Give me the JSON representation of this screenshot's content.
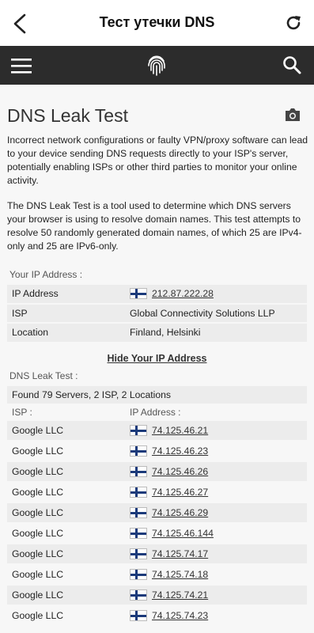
{
  "appbar": {
    "title": "Тест утечки DNS",
    "back_icon": "back-arrow-icon",
    "reload_icon": "reload-icon"
  },
  "navbar": {
    "menu_icon": "hamburger-menu-icon",
    "logo_icon": "fingerprint-icon",
    "search_icon": "search-icon",
    "bg_color": "#2c2c2c"
  },
  "page": {
    "title": "DNS Leak Test",
    "intro": "Incorrect network configurations or faulty VPN/proxy software can lead to your device sending DNS requests directly to your ISP's server, potentially enabling ISPs or other third parties to monitor your online activity.",
    "description": "The DNS Leak Test is a tool used to determine which DNS servers your browser is using to resolve domain names. This test attempts to resolve 50 randomly generated domain names, of which 25 are IPv4-only and 25 are IPv6-only."
  },
  "ip_section": {
    "label": "Your IP Address :",
    "rows": [
      {
        "key": "IP Address",
        "value": "212.87.222.28",
        "flag": true
      },
      {
        "key": "ISP",
        "value": "Global Connectivity Solutions LLP",
        "flag": false
      },
      {
        "key": "Location",
        "value": "Finland, Helsinki",
        "flag": false
      }
    ],
    "hide_link": "Hide Your IP Address"
  },
  "leak_section": {
    "label": "DNS Leak Test :",
    "summary": "Found 79 Servers, 2 ISP, 2 Locations",
    "col_isp": "ISP :",
    "col_ip": "IP Address :",
    "servers": [
      {
        "isp": "Google LLC",
        "ip": "74.125.46.21"
      },
      {
        "isp": "Google LLC",
        "ip": "74.125.46.23"
      },
      {
        "isp": "Google LLC",
        "ip": "74.125.46.26"
      },
      {
        "isp": "Google LLC",
        "ip": "74.125.46.27"
      },
      {
        "isp": "Google LLC",
        "ip": "74.125.46.29"
      },
      {
        "isp": "Google LLC",
        "ip": "74.125.46.144"
      },
      {
        "isp": "Google LLC",
        "ip": "74.125.74.17"
      },
      {
        "isp": "Google LLC",
        "ip": "74.125.74.18"
      },
      {
        "isp": "Google LLC",
        "ip": "74.125.74.21"
      },
      {
        "isp": "Google LLC",
        "ip": "74.125.74.23"
      }
    ]
  }
}
